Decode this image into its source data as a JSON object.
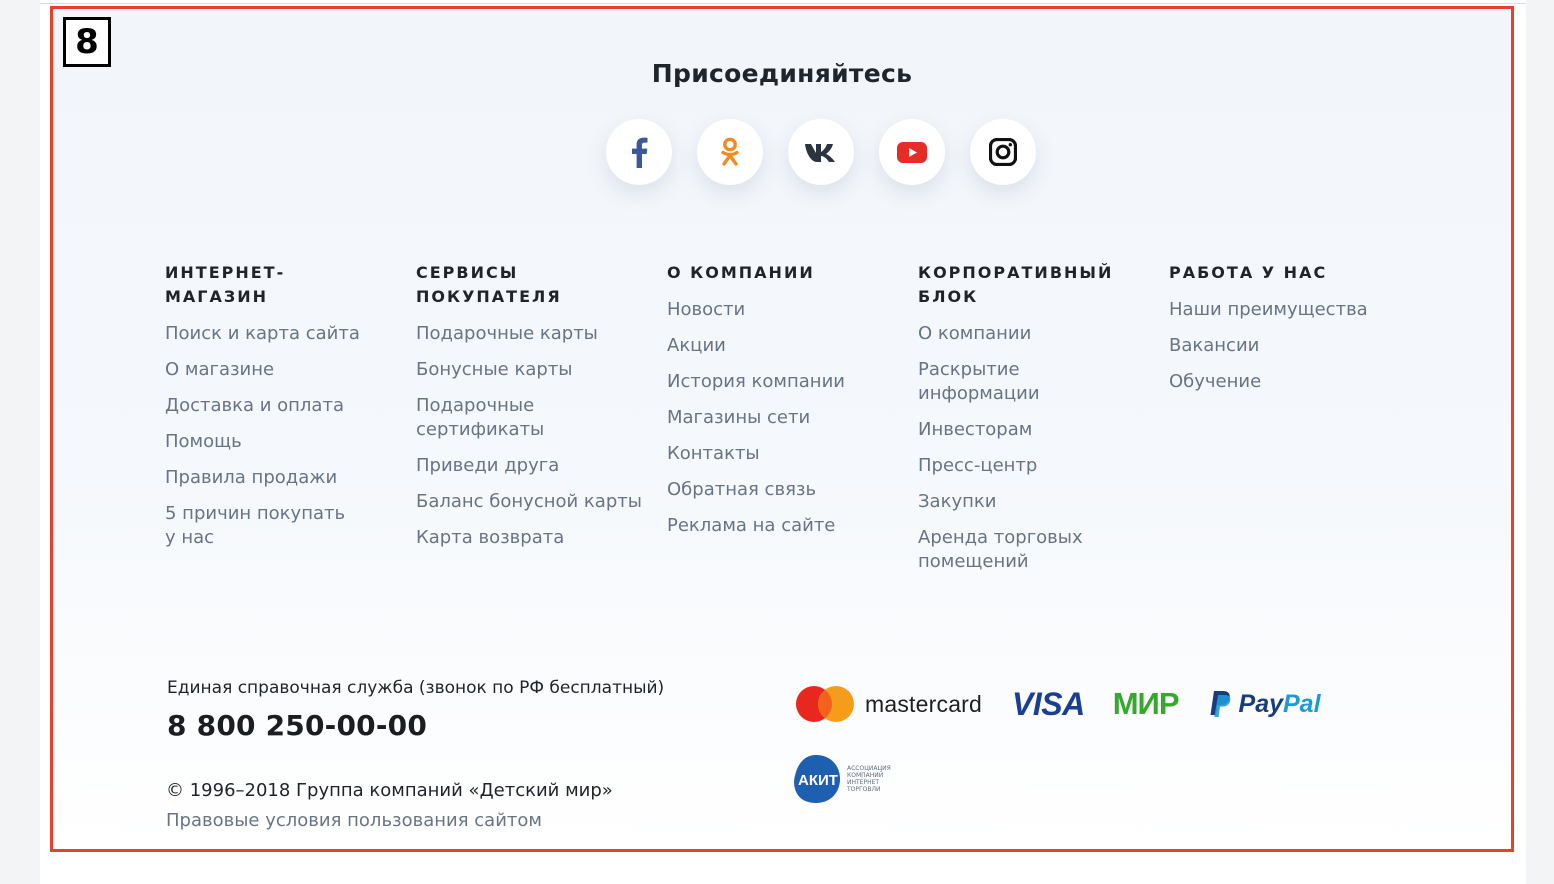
{
  "badge": "8",
  "join": {
    "title": "Присоединяйтесь",
    "socials": [
      {
        "name": "facebook-icon",
        "color": "#3b5998"
      },
      {
        "name": "odnoklassniki-icon",
        "color": "#f08a24"
      },
      {
        "name": "vk-icon",
        "color": "#2b3540"
      },
      {
        "name": "youtube-icon",
        "color": "#e52d27"
      },
      {
        "name": "instagram-icon",
        "color": "#111111"
      }
    ]
  },
  "columns": [
    {
      "title": "ИНТЕРНЕТ-МАГАЗИН",
      "links": [
        "Поиск и карта сайта",
        "О магазине",
        "Доставка и оплата",
        "Помощь",
        "Правила продажи",
        "5 причин покупать у нас"
      ]
    },
    {
      "title": "СЕРВИСЫ ПОКУПАТЕЛЯ",
      "links": [
        "Подарочные карты",
        "Бонусные карты",
        "Подарочные сертификаты",
        "Приведи друга",
        "Баланс бонусной карты",
        "Карта возврата"
      ]
    },
    {
      "title": "О КОМПАНИИ",
      "links": [
        "Новости",
        "Акции",
        "История компании",
        "Магазины сети",
        "Контакты",
        "Обратная связь",
        "Реклама на сайте"
      ]
    },
    {
      "title": "КОРПОРАТИВНЫЙ БЛОК",
      "links": [
        "О компании",
        "Раскрытие информации",
        "Инвесторам",
        "Пресс-центр",
        "Закупки",
        "Аренда торговых помещений"
      ]
    },
    {
      "title": "РАБОТА У НАС",
      "links": [
        "Наши преимущества",
        "Вакансии",
        "Обучение"
      ]
    }
  ],
  "contacts": {
    "help_label": "Единая справочная служба (звонок по РФ бесплатный)",
    "phone": "8 800 250-00-00",
    "copyright": "© 1996–2018 Группа компаний «Детский мир»",
    "terms": "Правовые условия пользования сайтом"
  },
  "payments": {
    "mastercard": "mastercard",
    "visa": "VISA",
    "mir": "МИР",
    "paypal_pay": "Pay",
    "paypal_pal": "Pal",
    "akit": "АКИТ",
    "akit_sub": "АССОЦИАЦИЯ КОМПАНИЙ ИНТЕРНЕТ ТОРГОВЛИ"
  },
  "colors": {
    "frame_border": "#e8402d",
    "link": "#687484",
    "heading": "#1f242a"
  }
}
